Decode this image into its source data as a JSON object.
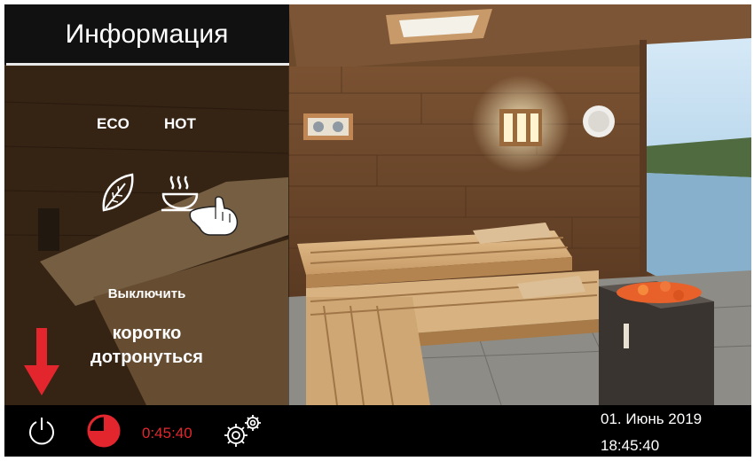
{
  "header": {
    "title": "Информация"
  },
  "modes": [
    {
      "label": "ECO",
      "icon": "leaf-icon"
    },
    {
      "label": "HOT",
      "icon": "steam-cup-icon"
    }
  ],
  "instructions": {
    "off_label": "Выключить",
    "hint_line1": "коротко",
    "hint_line2": "дотронуться"
  },
  "status_bar": {
    "timer": "0:45:40",
    "timer_progress": 0.75,
    "date": "01. Июнь 2019",
    "time": "18:45:40"
  },
  "colors": {
    "accent": "#e3262e",
    "bar_background": "#000000",
    "title_background": "#111111"
  },
  "icons": [
    "leaf-icon",
    "steam-cup-icon",
    "pointing-hand-icon",
    "arrow-down-icon",
    "power-icon",
    "timer-icon",
    "settings-gears-icon"
  ]
}
